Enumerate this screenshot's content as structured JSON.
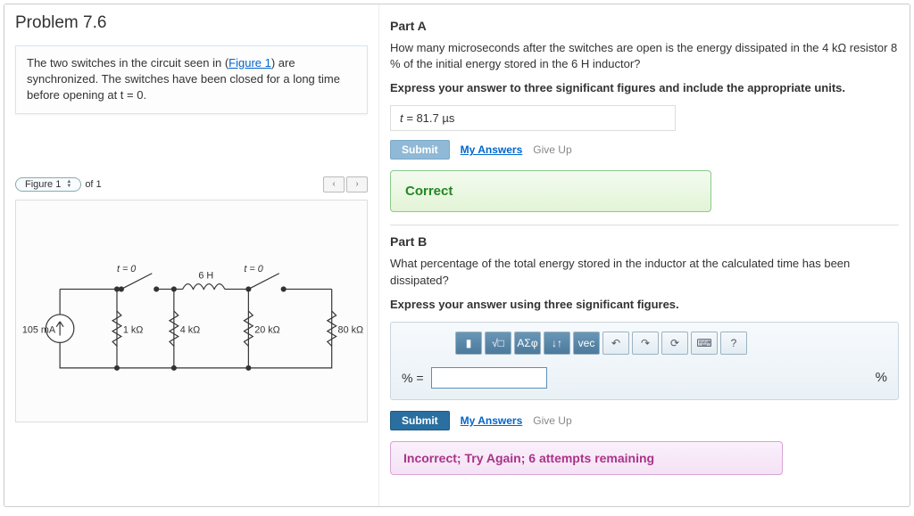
{
  "problem": {
    "title": "Problem 7.6",
    "description_pre": "The two switches in the circuit seen in (",
    "figure_link": "Figure 1",
    "description_post": ") are synchronized. The switches have been closed for a long time before opening at t = 0."
  },
  "figure": {
    "label": "Figure 1",
    "of_text": "of 1",
    "prev": "‹",
    "next": "›",
    "circuit_labels": {
      "t0_left": "t = 0",
      "t0_right": "t = 0",
      "inductor": "6 H",
      "source": "105 mA",
      "r1": "1 kΩ",
      "r2": "4 kΩ",
      "r3": "20 kΩ",
      "r4": "80 kΩ"
    }
  },
  "partA": {
    "title": "Part A",
    "question": "How many microseconds after the switches are open is the energy dissipated in the 4 kΩ resistor 8 % of the initial energy stored in the 6 H inductor?",
    "instruction": "Express your answer to three significant figures and include the appropriate units.",
    "answer_prefix": "t = ",
    "answer_value": "81.7 µs",
    "submit": "Submit",
    "my_answers": "My Answers",
    "give_up": "Give Up",
    "feedback": "Correct"
  },
  "partB": {
    "title": "Part B",
    "question": "What percentage of the total energy stored in the inductor at the calculated time has been dissipated?",
    "instruction": "Express your answer using three significant figures.",
    "toolbar": {
      "b1": "▮",
      "b2": "√□",
      "b3": "ΑΣφ",
      "b4": "↓↑",
      "b5": "vec",
      "undo": "↶",
      "redo": "↷",
      "reset": "⟳",
      "keyboard": "⌨",
      "help": "?"
    },
    "var_label": "% =",
    "unit": "%",
    "submit": "Submit",
    "my_answers": "My Answers",
    "give_up": "Give Up",
    "feedback": "Incorrect; Try Again; 6 attempts remaining"
  }
}
